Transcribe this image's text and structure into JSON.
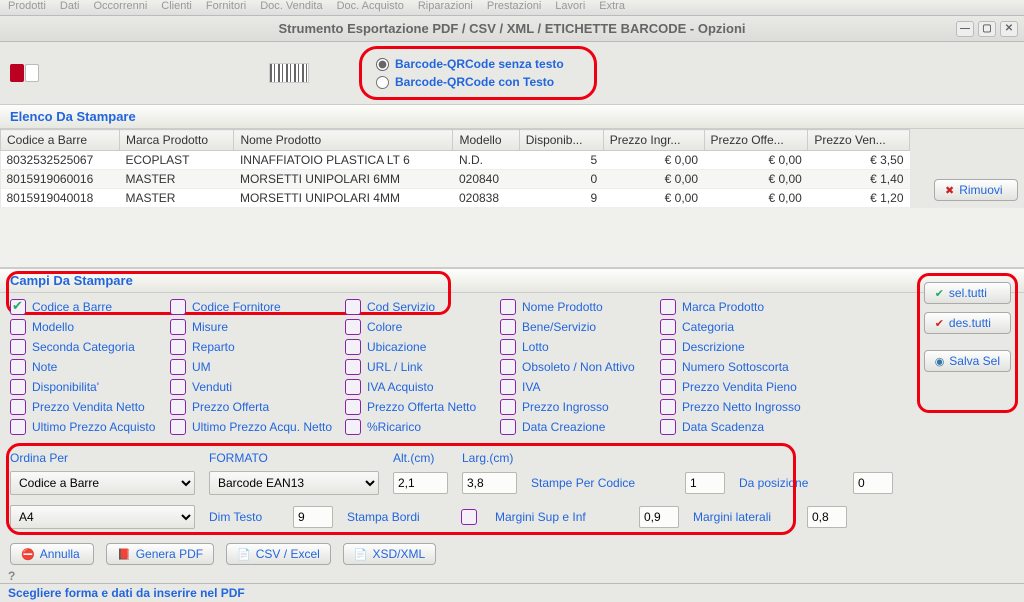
{
  "menubar": [
    "Prodotti",
    "Dati",
    "Occorrenni",
    "Clienti",
    "Fornitori",
    "Doc. Vendita",
    "Doc. Acquisto",
    "Riparazioni",
    "Prestazioni",
    "Lavori",
    "Extra"
  ],
  "window_title": "Strumento Esportazione PDF / CSV / XML / ETICHETTE BARCODE - Opzioni",
  "radio": {
    "without": "Barcode-QRCode senza testo",
    "with": "Barcode-QRCode con Testo"
  },
  "list_header": "Elenco Da Stampare",
  "table": {
    "cols": [
      "Codice a Barre",
      "Marca Prodotto",
      "Nome Prodotto",
      "Modello",
      "Disponib...",
      "Prezzo Ingr...",
      "Prezzo Offe...",
      "Prezzo Ven..."
    ],
    "rows": [
      {
        "c": "8032532525067",
        "m": "ECOPLAST",
        "n": "INNAFFIATOIO PLASTICA LT 6",
        "mo": "N.D.",
        "d": "5",
        "pi": "€ 0,00",
        "po": "€ 0,00",
        "pv": "€ 3,50"
      },
      {
        "c": "8015919060016",
        "m": "MASTER",
        "n": "MORSETTI UNIPOLARI 6MM",
        "mo": "020840",
        "d": "0",
        "pi": "€ 0,00",
        "po": "€ 0,00",
        "pv": "€ 1,40"
      },
      {
        "c": "8015919040018",
        "m": "MASTER",
        "n": "MORSETTI UNIPOLARI 4MM",
        "mo": "020838",
        "d": "9",
        "pi": "€ 0,00",
        "po": "€ 0,00",
        "pv": "€ 1,20"
      }
    ]
  },
  "rimuovi": "Rimuovi",
  "fields_header": "Campi Da Stampare",
  "fields": [
    {
      "l": "Codice a Barre",
      "ck": true
    },
    {
      "l": "Codice Fornitore"
    },
    {
      "l": "Cod Servizio"
    },
    {
      "l": "Nome Prodotto"
    },
    {
      "l": "Marca Prodotto"
    },
    {
      "l": "Modello"
    },
    {
      "l": "Misure"
    },
    {
      "l": "Colore"
    },
    {
      "l": "Bene/Servizio"
    },
    {
      "l": "Categoria"
    },
    {
      "l": "Seconda Categoria"
    },
    {
      "l": "Reparto"
    },
    {
      "l": "Ubicazione"
    },
    {
      "l": "Lotto"
    },
    {
      "l": "Descrizione"
    },
    {
      "l": "Note"
    },
    {
      "l": "UM"
    },
    {
      "l": "URL / Link"
    },
    {
      "l": "Obsoleto / Non Attivo"
    },
    {
      "l": "Numero Sottoscorta"
    },
    {
      "l": "Disponibilita'"
    },
    {
      "l": "Venduti"
    },
    {
      "l": "IVA Acquisto"
    },
    {
      "l": "IVA"
    },
    {
      "l": "Prezzo Vendita Pieno"
    },
    {
      "l": "Prezzo Vendita Netto"
    },
    {
      "l": "Prezzo Offerta"
    },
    {
      "l": "Prezzo Offerta Netto"
    },
    {
      "l": "Prezzo Ingrosso"
    },
    {
      "l": "Prezzo Netto Ingrosso"
    },
    {
      "l": "Ultimo Prezzo Acquisto"
    },
    {
      "l": "Ultimo Prezzo Acqu. Netto"
    },
    {
      "l": "%Ricarico"
    },
    {
      "l": "Data Creazione"
    },
    {
      "l": "Data Scadenza"
    }
  ],
  "sel_tutti": "sel.tutti",
  "des_tutti": "des.tutti",
  "salva_sel": "Salva Sel",
  "settings": {
    "ordina_label": "Ordina Per",
    "ordina_value": "Codice a Barre",
    "formato_label": "FORMATO",
    "formato_value": "Barcode EAN13",
    "alt_label": "Alt.(cm)",
    "alt_value": "2,1",
    "larg_label": "Larg.(cm)",
    "larg_value": "3,8",
    "stampe_label": "Stampe Per Codice",
    "stampe_value": "1",
    "dapos_label": "Da posizione",
    "dapos_value": "0",
    "pagesize": "A4",
    "dimtesto_label": "Dim Testo",
    "dimtesto_value": "9",
    "bordi_label": "Stampa Bordi",
    "margini_si_label": "Margini Sup e Inf",
    "margini_si_value": "0,9",
    "margini_lat_label": "Margini laterali",
    "margini_lat_value": "0,8"
  },
  "buttons": {
    "annulla": "Annulla",
    "genera": "Genera PDF",
    "csv": "CSV / Excel",
    "xsd": "XSD/XML"
  },
  "status": "Scegliere forma e dati da inserire nel PDF"
}
